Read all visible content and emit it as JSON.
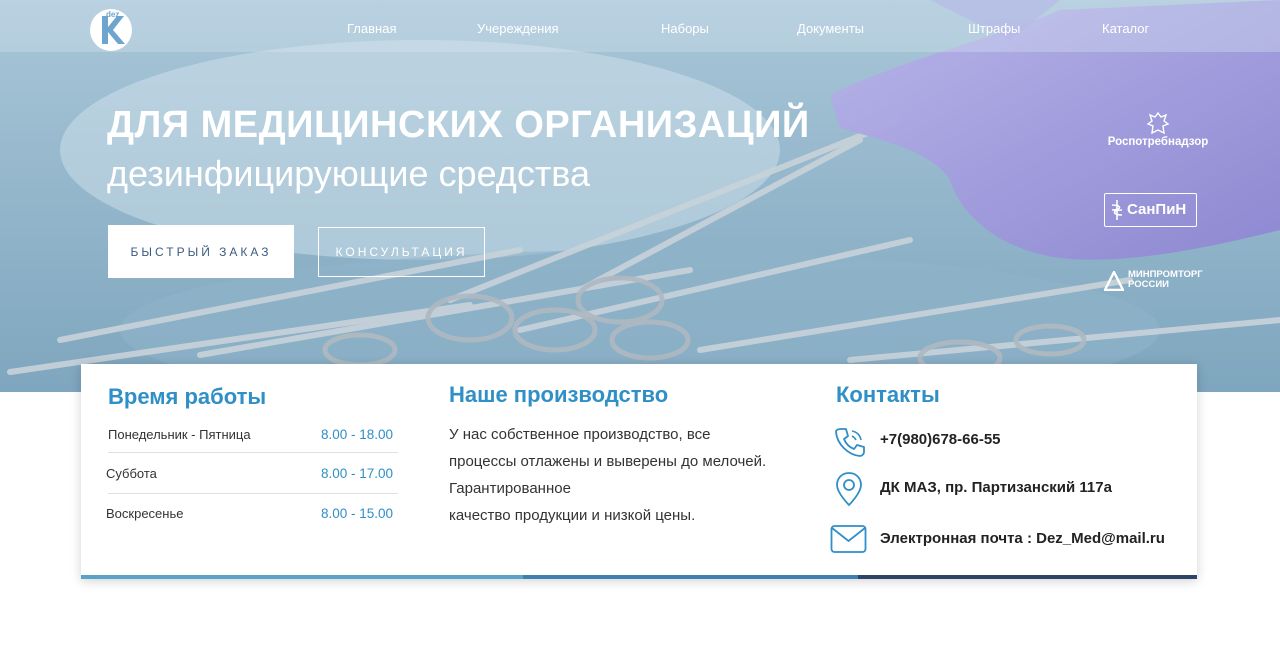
{
  "brand": {
    "logo_letter": "K",
    "logo_small": "dez"
  },
  "nav": {
    "items": [
      {
        "label": "Главная"
      },
      {
        "label": "Учереждения"
      },
      {
        "label": "Наборы"
      },
      {
        "label": "Документы"
      },
      {
        "label": "Штрафы"
      },
      {
        "label": "Каталог"
      }
    ]
  },
  "hero": {
    "title": "ДЛЯ МЕДИЦИНСКИХ ОРГАНИЗАЦИЙ",
    "subtitle": "дезинфицирующие средства",
    "btn_quick": "БЫСТРЫЙ ЗАКАЗ",
    "btn_consult": "КОНСУЛЬТАЦИЯ",
    "badges": {
      "rpn": "Роспотребнадзор",
      "sanpin": "СанПиН",
      "minprom": "МИНПРОМТОРГ\nРОССИИ"
    }
  },
  "schedule": {
    "title": "Время работы",
    "rows": [
      {
        "day": "Понедельник - Пятница",
        "time": "8.00 - 18.00"
      },
      {
        "day": "Суббота",
        "time": "8.00 - 17.00"
      },
      {
        "day": "Воскресенье",
        "time": "8.00 - 15.00"
      }
    ]
  },
  "production": {
    "title": "Наше производство",
    "lines": [
      "У нас собственное производство,   все",
      "процессы отлажены и выверены до мелочей.",
      "Гарантированное",
      "качество продукции и низкой цены."
    ]
  },
  "contacts": {
    "title": "Контакты",
    "phone": "+7(980)678-66-55",
    "address": "ДК МАЗ, пр. Партизанский 117а",
    "email": "Электронная почта : Dez_Med@mail.ru"
  },
  "colors": {
    "accent": "#2f8fc6",
    "bar_light": "#5aa3c8",
    "bar_mid": "#3d7fb0",
    "bar_dark": "#2c4468"
  },
  "icons": [
    "phone-icon",
    "location-pin-icon",
    "mail-icon"
  ]
}
